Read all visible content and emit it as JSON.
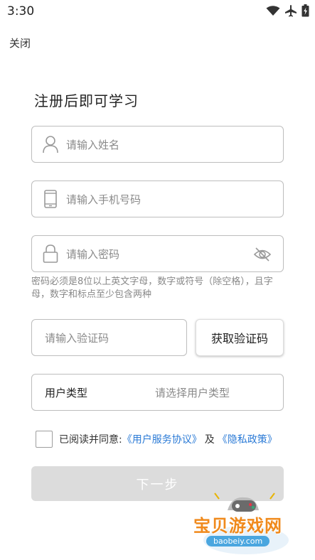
{
  "status_bar": {
    "time": "3:30",
    "icons": [
      "wifi-icon",
      "airplane-icon",
      "battery-icon"
    ]
  },
  "header": {
    "close_label": "关闭"
  },
  "form": {
    "title": "注册后即可学习",
    "name_placeholder": "请输入姓名",
    "phone_placeholder": "请输入手机号码",
    "password_placeholder": "请输入密码",
    "password_hint": "密码必须是8位以上英文字母，数字或符号（除空格），且字母，数字和标点至少包含两种",
    "code_placeholder": "请输入验证码",
    "get_code_label": "获取验证码",
    "user_type_label": "用户类型",
    "user_type_placeholder": "请选择用户类型",
    "agreement": {
      "checked": false,
      "prefix": "已阅读并同意:",
      "service_link": "《用户服务协议》",
      "and": "及",
      "privacy_link": "《隐私政策》"
    },
    "next_label": "下一步"
  },
  "watermark": {
    "text": "宝贝游戏网",
    "domain": "baobeiy.com"
  },
  "colors": {
    "link": "#2a7ad6",
    "disabled_button": "#dcdcdc",
    "border": "#bdbdbd",
    "watermark": "#f08a1c"
  }
}
